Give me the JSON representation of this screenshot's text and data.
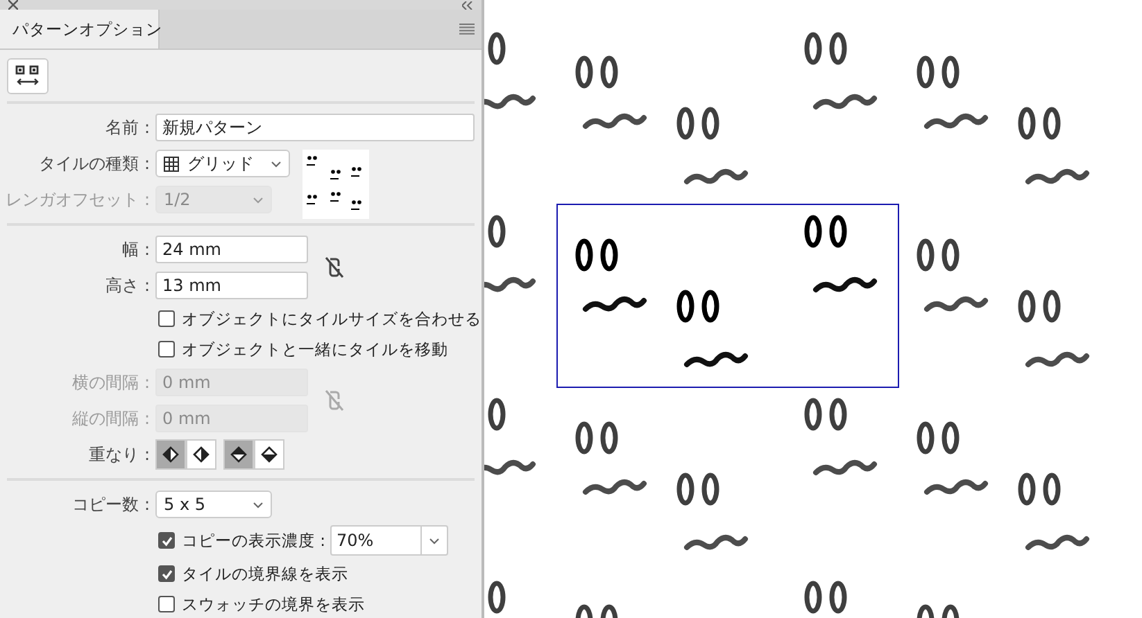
{
  "panel": {
    "tab": "パターンオプション"
  },
  "name": {
    "label": "名前 :",
    "value": "新規パターン"
  },
  "tile_type": {
    "label": "タイルの種類 :",
    "value": "グリッド"
  },
  "brick_offset": {
    "label": "レンガオフセット :",
    "value": "1/2",
    "disabled": true
  },
  "width": {
    "label": "幅 :",
    "value": "24 mm"
  },
  "height": {
    "label": "高さ :",
    "value": "13 mm"
  },
  "size_options": [
    {
      "label": "オブジェクトにタイルサイズを合わせる",
      "checked": false
    },
    {
      "label": "オブジェクトと一緒にタイルを移動",
      "checked": false
    }
  ],
  "h_spacing": {
    "label": "横の間隔 :",
    "value": "0 mm",
    "disabled": true
  },
  "v_spacing": {
    "label": "縦の間隔 :",
    "value": "0 mm",
    "disabled": true
  },
  "overlap": {
    "label": "重なり :",
    "buttons": [
      {
        "kind": "left",
        "selected": true
      },
      {
        "kind": "right",
        "selected": false
      },
      {
        "kind": "top",
        "selected": true
      },
      {
        "kind": "bottom",
        "selected": false
      }
    ]
  },
  "copies": {
    "label": "コピー数 :",
    "value": "5 x 5"
  },
  "dim_copies": {
    "label": "コピーの表示濃度 :",
    "checked": true,
    "value": "70%"
  },
  "display_options": [
    {
      "label": "タイルの境界線を表示",
      "checked": true
    },
    {
      "label": "スウォッチの境界を表示",
      "checked": false
    }
  ]
}
